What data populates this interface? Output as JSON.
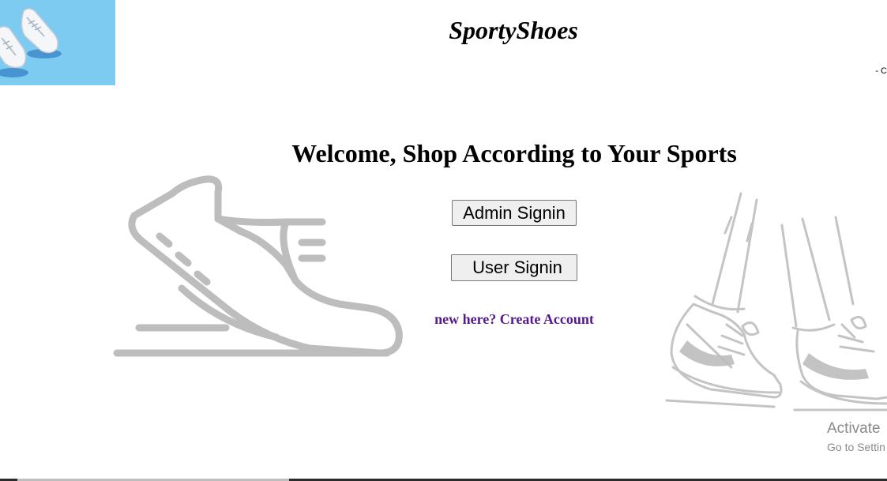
{
  "header": {
    "brand": "SportyShoes",
    "logo_icon": "sneakers-icon",
    "corner_mark": "- C"
  },
  "main": {
    "welcome": "Welcome, Shop According to Your Sports",
    "admin_button": "Admin Signin",
    "user_button": "User Signin",
    "create_link": "new here? Create Account"
  },
  "decorations": {
    "left_art": "running-shoe-icon",
    "right_art": "walking-sneakers-icon"
  },
  "watermark": {
    "title": "Activate",
    "subtitle": "Go to Settin"
  },
  "colors": {
    "logo_bg": "#7ecbf1",
    "link": "#551a8b",
    "art_stroke": "#bdbdbd"
  }
}
